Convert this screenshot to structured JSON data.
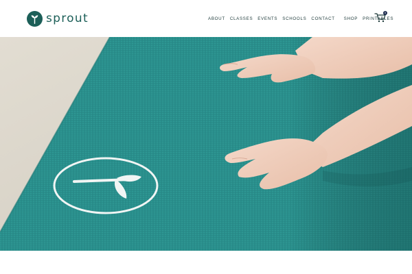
{
  "brand": {
    "name": "sprout",
    "logo_icon": "sprout-leaf-icon",
    "color": "#1c5f58"
  },
  "nav": {
    "items": [
      {
        "label": "ABOUT"
      },
      {
        "label": "CLASSES"
      },
      {
        "label": "EVENTS"
      },
      {
        "label": "SCHOOLS"
      },
      {
        "label": "CONTACT"
      },
      {
        "label": "SHOP"
      },
      {
        "label": "PRINTABLES"
      }
    ]
  },
  "cart": {
    "icon": "shopping-cart-icon",
    "count": "0"
  },
  "hero": {
    "image": "Child's hands resting on a teal yoga mat printed with a circular sprout logo",
    "mat_color": "#2a8f8c",
    "floor_color": "#d9d4c8"
  }
}
